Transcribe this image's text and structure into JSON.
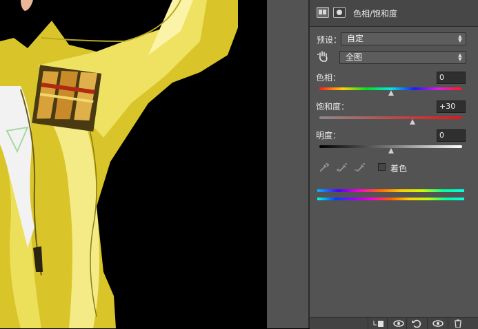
{
  "panel": {
    "title": "色相/饱和度",
    "preset_label": "预设：",
    "preset_value": "自定",
    "range_value": "全图",
    "hue": {
      "label": "色相：",
      "value": "0",
      "level": 0.5
    },
    "saturation": {
      "label": "饱和度：",
      "value": "+30",
      "level": 0.65
    },
    "lightness": {
      "label": "明度：",
      "value": "0",
      "level": 0.5
    },
    "colorize_label": "着色"
  },
  "icons": {
    "header": [
      "adjustment-layer-icon",
      "mask-icon"
    ],
    "tools": [
      "on-image-adjust-icon",
      "eyedropper-icon",
      "add-to-sample-icon",
      "subtract-from-sample-icon"
    ],
    "footer": [
      "clip-to-layer-icon",
      "view-previous-state-icon",
      "reset-icon",
      "visibility-icon",
      "delete-icon"
    ]
  },
  "colors": {
    "panel_bg": "#535353",
    "header_bg": "#474747",
    "jacket": "#e6d532"
  }
}
